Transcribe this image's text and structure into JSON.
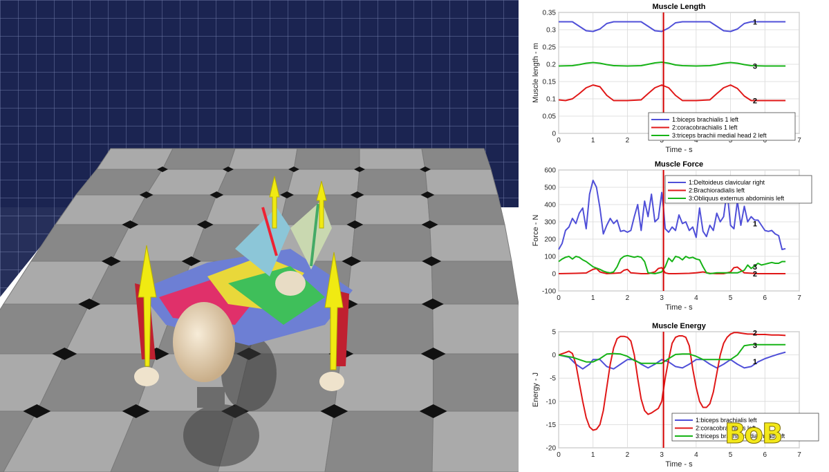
{
  "logo_text": "BoB",
  "colors": {
    "series1": "#4f4fd8",
    "series2": "#e01717",
    "series3": "#16b316",
    "time_marker": "#d40000",
    "grid_wall": "#1f2a57",
    "floor_light": "#aaaaaa",
    "floor_dark": "#888888",
    "arrow": "#f0ea12"
  },
  "scene": {
    "description_icons": [
      "skeleton-model-icon",
      "force-arrow-icon"
    ]
  },
  "time_marker": 3.05,
  "chart_data": [
    {
      "type": "line",
      "title": "Muscle Length",
      "xlabel": "Time - s",
      "ylabel": "Muscle length - m",
      "xlim": [
        0,
        7
      ],
      "ylim": [
        0,
        0.35
      ],
      "xticks": [
        0,
        1,
        2,
        3,
        4,
        5,
        6,
        7
      ],
      "yticks": [
        0,
        0.05,
        0.1,
        0.15,
        0.2,
        0.25,
        0.3,
        0.35
      ],
      "yticklabels": [
        "0",
        "0.05",
        "0.1",
        "0.15",
        "0.2",
        "0.25",
        "0.3",
        "0.35"
      ],
      "grid": true,
      "legend_position": "bottom-right",
      "legend": [
        "1:biceps brachialis 1 left",
        "2:coracobrachialis 1 left",
        "3:triceps brachii medial head 2 left"
      ],
      "series_labels": [
        {
          "text": "1",
          "x": 5.65,
          "y": 0.323
        },
        {
          "text": "2",
          "x": 5.65,
          "y": 0.095
        },
        {
          "text": "3",
          "x": 5.65,
          "y": 0.195
        }
      ],
      "series": [
        {
          "name": "1:biceps brachialis 1 left",
          "color": "#4f4fd8",
          "x": [
            0,
            0.4,
            0.6,
            0.8,
            1.0,
            1.2,
            1.4,
            1.6,
            2.0,
            2.4,
            2.6,
            2.8,
            3.0,
            3.2,
            3.4,
            3.6,
            4.0,
            4.4,
            4.6,
            4.8,
            5.0,
            5.2,
            5.4,
            5.6,
            6.0,
            6.6
          ],
          "y": [
            0.323,
            0.323,
            0.31,
            0.297,
            0.295,
            0.302,
            0.318,
            0.323,
            0.323,
            0.323,
            0.31,
            0.297,
            0.295,
            0.305,
            0.32,
            0.323,
            0.323,
            0.323,
            0.31,
            0.297,
            0.295,
            0.302,
            0.318,
            0.323,
            0.323,
            0.323
          ]
        },
        {
          "name": "2:coracobrachialis 1 left",
          "color": "#e01717",
          "x": [
            0,
            0.2,
            0.4,
            0.6,
            0.8,
            1.0,
            1.2,
            1.4,
            1.6,
            2.0,
            2.4,
            2.6,
            2.8,
            3.0,
            3.2,
            3.4,
            3.6,
            4.0,
            4.4,
            4.6,
            4.8,
            5.0,
            5.2,
            5.4,
            5.6,
            6.0,
            6.6
          ],
          "y": [
            0.097,
            0.095,
            0.1,
            0.115,
            0.132,
            0.14,
            0.135,
            0.11,
            0.095,
            0.095,
            0.097,
            0.115,
            0.132,
            0.14,
            0.132,
            0.11,
            0.095,
            0.095,
            0.097,
            0.115,
            0.132,
            0.14,
            0.13,
            0.108,
            0.095,
            0.095,
            0.095
          ]
        },
        {
          "name": "3:triceps brachii medial head 2 left",
          "color": "#16b316",
          "x": [
            0,
            0.4,
            0.6,
            0.8,
            1.0,
            1.2,
            1.4,
            1.6,
            2.0,
            2.4,
            2.6,
            2.8,
            3.0,
            3.2,
            3.4,
            3.6,
            4.0,
            4.4,
            4.6,
            4.8,
            5.0,
            5.2,
            5.4,
            5.6,
            6.0,
            6.6
          ],
          "y": [
            0.195,
            0.196,
            0.199,
            0.203,
            0.205,
            0.203,
            0.199,
            0.196,
            0.195,
            0.196,
            0.2,
            0.204,
            0.206,
            0.203,
            0.198,
            0.196,
            0.195,
            0.196,
            0.199,
            0.203,
            0.205,
            0.203,
            0.199,
            0.196,
            0.195,
            0.195
          ]
        }
      ]
    },
    {
      "type": "line",
      "title": "Muscle Force",
      "xlabel": "Time - s",
      "ylabel": "Force - N",
      "xlim": [
        0,
        7
      ],
      "ylim": [
        -100,
        600
      ],
      "xticks": [
        0,
        1,
        2,
        3,
        4,
        5,
        6,
        7
      ],
      "yticks": [
        -100,
        0,
        100,
        200,
        300,
        400,
        500,
        600
      ],
      "yticklabels": [
        "-100",
        "0",
        "100",
        "200",
        "300",
        "400",
        "500",
        "600"
      ],
      "grid": true,
      "legend_position": "top-right",
      "legend": [
        "1:Deltoideus clavicular right",
        "2:Brachioradialis left",
        "3:Obliquus externus abdominis left"
      ],
      "series_labels": [
        {
          "text": "1",
          "x": 5.65,
          "y": 290
        },
        {
          "text": "2",
          "x": 5.65,
          "y": 0
        },
        {
          "text": "3",
          "x": 5.65,
          "y": 40
        }
      ],
      "series": [
        {
          "name": "1:Deltoideus clavicular right",
          "color": "#4f4fd8",
          "x": [
            0,
            0.1,
            0.2,
            0.3,
            0.4,
            0.5,
            0.6,
            0.7,
            0.8,
            0.9,
            1.0,
            1.1,
            1.2,
            1.3,
            1.4,
            1.5,
            1.6,
            1.7,
            1.8,
            1.9,
            2.0,
            2.1,
            2.2,
            2.3,
            2.4,
            2.5,
            2.6,
            2.7,
            2.8,
            2.9,
            3.0,
            3.05,
            3.1,
            3.2,
            3.3,
            3.4,
            3.5,
            3.6,
            3.7,
            3.8,
            3.9,
            4.0,
            4.1,
            4.2,
            4.3,
            4.4,
            4.5,
            4.6,
            4.7,
            4.8,
            4.9,
            5.0,
            5.1,
            5.2,
            5.3,
            5.4,
            5.5,
            5.6,
            5.7,
            5.8,
            5.9,
            6.0,
            6.1,
            6.2,
            6.3,
            6.4,
            6.5,
            6.6
          ],
          "y": [
            140,
            175,
            250,
            270,
            320,
            290,
            350,
            380,
            260,
            460,
            540,
            500,
            380,
            230,
            280,
            320,
            290,
            310,
            245,
            250,
            240,
            250,
            330,
            400,
            250,
            420,
            330,
            460,
            300,
            320,
            470,
            380,
            260,
            240,
            270,
            250,
            340,
            290,
            300,
            250,
            270,
            210,
            380,
            245,
            215,
            280,
            250,
            350,
            300,
            330,
            480,
            280,
            260,
            420,
            280,
            390,
            300,
            330,
            310,
            310,
            280,
            250,
            245,
            250,
            230,
            220,
            140,
            145
          ]
        },
        {
          "name": "2:Brachioradialis left",
          "color": "#e01717",
          "x": [
            0,
            0.5,
            0.8,
            1.0,
            1.1,
            1.2,
            1.4,
            1.6,
            1.8,
            1.9,
            2.0,
            2.1,
            2.4,
            2.6,
            2.8,
            2.9,
            3.0,
            3.1,
            3.2,
            3.4,
            3.8,
            4.0,
            4.2,
            4.4,
            4.6,
            4.8,
            5.0,
            5.1,
            5.2,
            5.4,
            5.8,
            6.6
          ],
          "y": [
            0,
            2,
            4,
            25,
            30,
            10,
            0,
            2,
            5,
            20,
            25,
            5,
            0,
            0,
            10,
            30,
            35,
            5,
            0,
            0,
            2,
            5,
            10,
            2,
            0,
            0,
            10,
            35,
            38,
            5,
            0,
            0
          ]
        },
        {
          "name": "3:Obliquus externus abdominis left",
          "color": "#16b316",
          "x": [
            0,
            0.1,
            0.2,
            0.3,
            0.4,
            0.5,
            0.6,
            0.7,
            0.8,
            1.0,
            1.2,
            1.3,
            1.4,
            1.5,
            1.6,
            1.7,
            1.8,
            1.9,
            2.0,
            2.1,
            2.2,
            2.3,
            2.4,
            2.5,
            2.6,
            2.8,
            3.0,
            3.1,
            3.2,
            3.3,
            3.4,
            3.5,
            3.6,
            3.7,
            3.8,
            3.9,
            4.0,
            4.1,
            4.2,
            4.3,
            4.4,
            4.6,
            4.8,
            5.0,
            5.2,
            5.4,
            5.5,
            5.6,
            5.7,
            5.8,
            5.9,
            6.0,
            6.1,
            6.2,
            6.3,
            6.4,
            6.5,
            6.6
          ],
          "y": [
            70,
            85,
            95,
            100,
            85,
            100,
            95,
            80,
            70,
            40,
            25,
            15,
            8,
            5,
            10,
            40,
            85,
            100,
            105,
            100,
            95,
            100,
            95,
            70,
            5,
            0,
            10,
            40,
            90,
            70,
            100,
            95,
            80,
            100,
            90,
            95,
            85,
            80,
            40,
            5,
            0,
            5,
            5,
            5,
            5,
            20,
            50,
            30,
            45,
            60,
            50,
            55,
            60,
            65,
            60,
            60,
            70,
            70
          ]
        }
      ]
    },
    {
      "type": "line",
      "title": "Muscle Energy",
      "xlabel": "Time - s",
      "ylabel": "Energy - J",
      "xlim": [
        0,
        7
      ],
      "ylim": [
        -20,
        5
      ],
      "xticks": [
        0,
        1,
        2,
        3,
        4,
        5,
        6,
        7
      ],
      "yticks": [
        -20,
        -15,
        -10,
        -5,
        0,
        5
      ],
      "yticklabels": [
        "-20",
        "-15",
        "-10",
        "-5",
        "0",
        "5"
      ],
      "grid": true,
      "legend_position": "bottom-right",
      "legend": [
        "1:biceps brachialis left",
        "2:coracobrachialis left",
        "3:triceps brachii medial head left"
      ],
      "series_labels": [
        {
          "text": "2",
          "x": 5.65,
          "y": 4.8
        },
        {
          "text": "3",
          "x": 5.65,
          "y": 2.1
        },
        {
          "text": "1",
          "x": 5.65,
          "y": -1.4
        }
      ],
      "series": [
        {
          "name": "1:biceps brachialis left",
          "color": "#4f4fd8",
          "x": [
            0,
            0.3,
            0.5,
            0.7,
            0.9,
            1.0,
            1.2,
            1.4,
            1.6,
            1.8,
            2.0,
            2.2,
            2.4,
            2.6,
            2.8,
            3.0,
            3.2,
            3.4,
            3.6,
            3.8,
            4.0,
            4.2,
            4.4,
            4.6,
            4.8,
            5.0,
            5.2,
            5.4,
            5.6,
            5.8,
            6.0,
            6.2,
            6.4,
            6.6
          ],
          "y": [
            0,
            -0.5,
            -2,
            -3,
            -2,
            -1,
            -1,
            -2.5,
            -3,
            -2,
            -1,
            -1,
            -2,
            -2.8,
            -2,
            -1,
            -1.5,
            -2.5,
            -2.8,
            -2,
            -1,
            -1,
            -2,
            -2.8,
            -2,
            -1,
            -2,
            -2.8,
            -2.5,
            -1.5,
            -0.8,
            -0.3,
            0.2,
            0.6
          ]
        },
        {
          "name": "2:coracobrachialis 1 left",
          "color": "#e01717",
          "x": [
            0,
            0.2,
            0.3,
            0.4,
            0.5,
            0.6,
            0.7,
            0.8,
            0.9,
            1.0,
            1.1,
            1.2,
            1.3,
            1.4,
            1.5,
            1.6,
            1.7,
            1.8,
            1.9,
            2.0,
            2.1,
            2.2,
            2.3,
            2.4,
            2.5,
            2.6,
            2.7,
            2.8,
            2.9,
            3.0,
            3.1,
            3.2,
            3.3,
            3.4,
            3.5,
            3.6,
            3.7,
            3.8,
            3.9,
            4.0,
            4.1,
            4.2,
            4.3,
            4.4,
            4.5,
            4.6,
            4.7,
            4.8,
            4.9,
            5.0,
            5.1,
            5.2,
            5.3,
            5.4,
            5.5,
            5.6,
            5.8,
            6.0,
            6.2,
            6.4,
            6.6
          ],
          "y": [
            0,
            0.5,
            0.8,
            0.3,
            -2,
            -6,
            -10,
            -13.5,
            -15.5,
            -16.2,
            -16,
            -15,
            -12,
            -7,
            -2,
            1.5,
            3.5,
            4,
            4,
            3.8,
            3,
            0,
            -5,
            -9.5,
            -12,
            -12.8,
            -12.5,
            -12,
            -11.5,
            -10,
            -5,
            -1,
            2.5,
            3.8,
            4.1,
            4.1,
            3.8,
            2,
            -3,
            -7,
            -10,
            -11.3,
            -11.3,
            -10.5,
            -8,
            -4,
            0,
            2.5,
            3.8,
            4.5,
            4.8,
            4.8,
            4.7,
            4.6,
            4.5,
            4.5,
            4.4,
            4.4,
            4.3,
            4.3,
            4.2
          ]
        },
        {
          "name": "3:triceps brachii medial head left",
          "color": "#16b316",
          "x": [
            0,
            0.4,
            0.6,
            0.8,
            1.0,
            1.2,
            1.4,
            1.6,
            1.8,
            2.0,
            2.2,
            2.4,
            2.6,
            2.8,
            3.0,
            3.2,
            3.4,
            3.6,
            3.8,
            4.0,
            4.2,
            4.4,
            4.6,
            4.8,
            5.0,
            5.2,
            5.4,
            5.6,
            5.8,
            6.0,
            6.2,
            6.4,
            6.6
          ],
          "y": [
            0,
            -0.5,
            -1,
            -1.5,
            -1.5,
            -0.8,
            0.2,
            0.3,
            0.2,
            -0.3,
            -1.2,
            -1.8,
            -1.8,
            -1.8,
            -1.8,
            -0.8,
            0.1,
            0.2,
            0.2,
            -0.3,
            -1,
            -1,
            -1,
            -1,
            -1,
            0,
            2,
            2.2,
            2.2,
            2.2,
            2.2,
            2.2,
            2.2
          ]
        }
      ]
    }
  ]
}
